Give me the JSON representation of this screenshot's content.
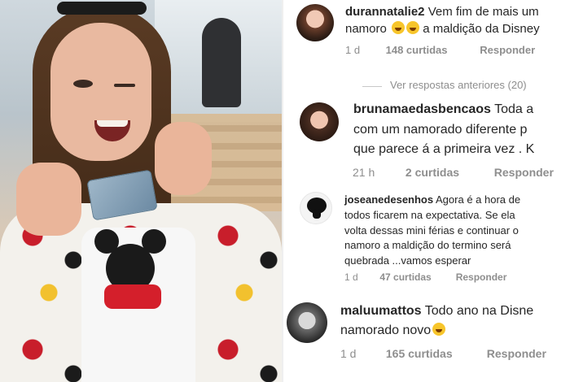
{
  "comments": [
    {
      "username": "durannatalie2",
      "text_line1": "Vem fim de mais um",
      "text_line2_a": "namoro",
      "text_line2_b": "a maldição da Disney",
      "time": "1 d",
      "likes": "148 curtidas",
      "reply": "Responder"
    },
    {
      "username": "brunamaedasbencaos",
      "text_line1": "Toda a",
      "text_line2": "com um namorado  diferente p",
      "text_line3": "que parece á a primeira vez . K",
      "time": "21 h",
      "likes": "2 curtidas",
      "reply": "Responder"
    },
    {
      "username": "joseanedesenhos",
      "text_line1": "Agora é a hora de",
      "text_line2": "todos ficarem na expectativa. Se ela",
      "text_line3": "volta dessas mini férias e continuar o",
      "text_line4": "namoro a maldição do termino será",
      "text_line5": "quebrada ...vamos esperar",
      "time": "1 d",
      "likes": "47 curtidas",
      "reply": "Responder"
    },
    {
      "username": "maluumattos",
      "text_line1": "Todo ano na Disne",
      "text_line2": "namorado novo",
      "time": "1 d",
      "likes": "165 curtidas",
      "reply": "Responder"
    }
  ],
  "see_more_replies": "Ver respostas anteriores (20)",
  "colors": {
    "text": "#262626",
    "meta": "#8e8e8e",
    "background": "#ffffff"
  },
  "icons": [
    "smiling-emoji-icon"
  ]
}
